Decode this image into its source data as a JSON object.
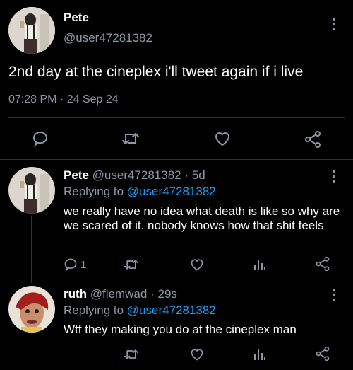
{
  "main_tweet": {
    "author_name": "Pete",
    "handle": "@user47281382",
    "text": "2nd day at the cineplex i'll tweet again if i live",
    "time": "07:28 PM",
    "date": "24 Sep 24"
  },
  "replies": [
    {
      "author_name": "Pete",
      "handle": "@user47281382",
      "age": "5d",
      "replying_prefix": "Replying to",
      "replying_handle": "@user47281382",
      "text": "we really have no idea what death is like so why are we scared of it. nobody knows how that shit feels",
      "reply_count": "1"
    },
    {
      "author_name": "ruth",
      "handle": "@flemwad",
      "age": "29s",
      "replying_prefix": "Replying to",
      "replying_handle": "@user47281382",
      "text": "Wtf they making you do at the cineplex man"
    }
  ],
  "separator": "·",
  "icons": [
    "reply-icon",
    "retweet-icon",
    "like-icon",
    "share-icon",
    "analytics-icon",
    "more-icon"
  ],
  "colors": {
    "background": "#000000",
    "muted": "#8b98a5",
    "link": "#1d9bf0",
    "divider": "#2f3336"
  }
}
